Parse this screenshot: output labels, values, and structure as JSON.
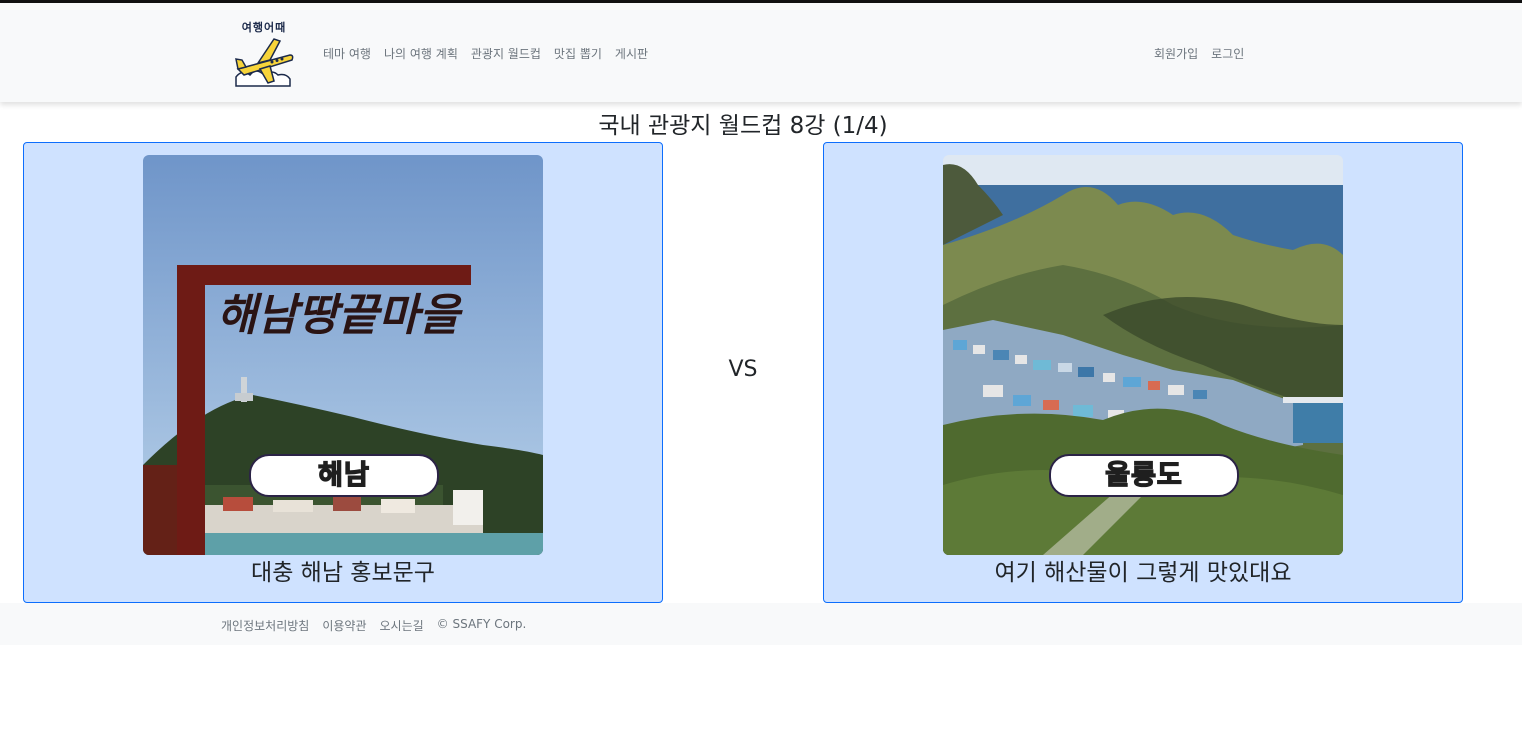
{
  "header": {
    "logo_text": "여행어때",
    "nav_links": [
      "테마 여행",
      "나의 여행 계획",
      "관광지 월드컵",
      "맛집 뽑기",
      "게시판"
    ],
    "auth_links": [
      "회원가입",
      "로그인"
    ]
  },
  "main": {
    "title": "국내 관광지 월드컵 8강 (1/4)",
    "vs_text": "VS",
    "candidates": [
      {
        "name": "해남",
        "sign_text": "해남땅끝마을",
        "description": "대충 해남 홍보문구"
      },
      {
        "name": "울릉도",
        "description": "여기 해산물이 그렇게 맛있대요"
      }
    ]
  },
  "footer": {
    "links": [
      "개인정보처리방침",
      "이용약관",
      "오시는길"
    ],
    "copyright": "© SSAFY Corp."
  },
  "colors": {
    "card_bg": "#cfe2ff",
    "card_border": "#0d6efd",
    "badge_text": "#d7f27a",
    "nav_text": "#6c757d"
  }
}
